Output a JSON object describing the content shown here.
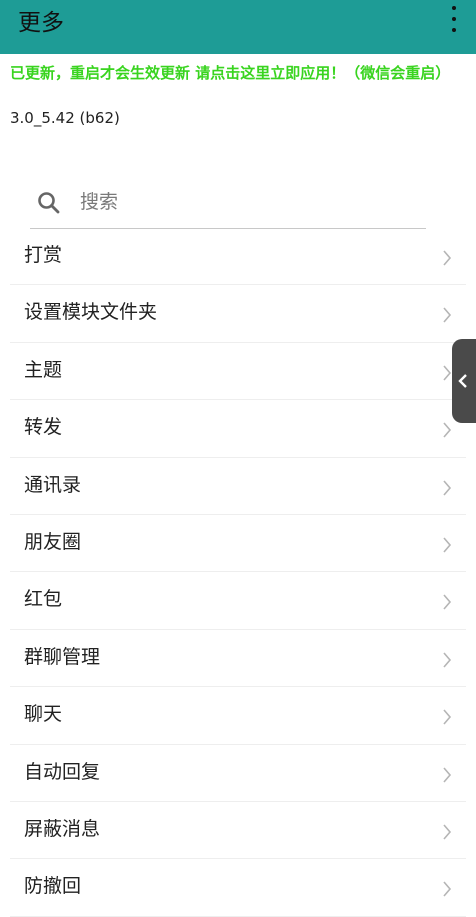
{
  "appbar": {
    "title": "更多",
    "overflow_icon": "more-vert-icon"
  },
  "notice": "已更新，重启才会生效更新 请点击这里立即应用！（微信会重启）",
  "version": "3.0_5.42 (b62)",
  "search": {
    "placeholder": "搜索",
    "value": ""
  },
  "menu": [
    {
      "label": "打赏"
    },
    {
      "label": "设置模块文件夹"
    },
    {
      "label": "主题"
    },
    {
      "label": "转发"
    },
    {
      "label": "通讯录"
    },
    {
      "label": "朋友圈"
    },
    {
      "label": "红包"
    },
    {
      "label": "群聊管理"
    },
    {
      "label": "聊天"
    },
    {
      "label": "自动回复"
    },
    {
      "label": "屏蔽消息"
    },
    {
      "label": "防撤回"
    }
  ],
  "colors": {
    "appbar": "#1e9c96",
    "notice": "#39d41f",
    "handle": "#4a4a4a"
  }
}
